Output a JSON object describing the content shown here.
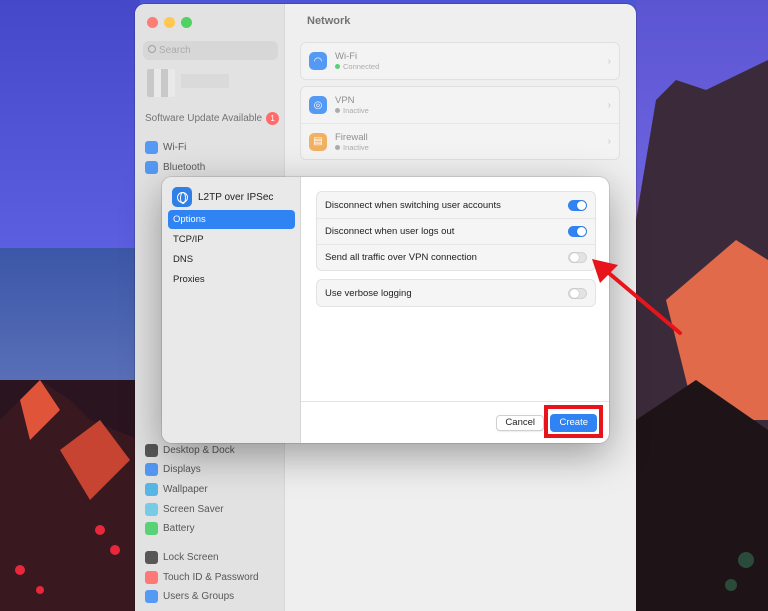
{
  "sidebar": {
    "search_placeholder": "Search",
    "update_text": "Software Update Available",
    "update_badge": "1",
    "items_top": [
      {
        "label": "Wi-Fi",
        "icon": "wifi-icon",
        "color": "#2f83f2"
      },
      {
        "label": "Bluetooth",
        "icon": "bluetooth-icon",
        "color": "#2f83f2"
      }
    ],
    "items_bottom": [
      {
        "label": "Desktop & Dock",
        "icon": "dock-icon",
        "color": "#333333"
      },
      {
        "label": "Displays",
        "icon": "display-icon",
        "color": "#2f83f2"
      },
      {
        "label": "Wallpaper",
        "icon": "wallpaper-icon",
        "color": "#34a7e0"
      },
      {
        "label": "Screen Saver",
        "icon": "screensaver-icon",
        "color": "#5ac0e0"
      },
      {
        "label": "Battery",
        "icon": "battery-icon",
        "color": "#34c759"
      },
      {
        "label": "Lock Screen",
        "icon": "lock-icon",
        "color": "#333333"
      },
      {
        "label": "Touch ID & Password",
        "icon": "fingerprint-icon",
        "color": "#ff5b5b"
      },
      {
        "label": "Users & Groups",
        "icon": "users-icon",
        "color": "#2f83f2"
      }
    ]
  },
  "main": {
    "title": "Network",
    "wifi": {
      "title": "Wi-Fi",
      "status": "Connected",
      "status_color": "#34c759"
    },
    "vpn": {
      "title": "VPN",
      "status": "Inactive",
      "status_color": "#9a9a9a"
    },
    "firewall": {
      "title": "Firewall",
      "status": "Inactive",
      "status_color": "#9a9a9a"
    }
  },
  "dialog": {
    "title": "L2TP over IPSec",
    "nav": [
      "Options",
      "TCP/IP",
      "DNS",
      "Proxies"
    ],
    "options_group1": [
      {
        "label": "Disconnect when switching user accounts",
        "on": true
      },
      {
        "label": "Disconnect when user logs out",
        "on": true
      },
      {
        "label": "Send all traffic over VPN connection",
        "on": false
      }
    ],
    "options_group2": [
      {
        "label": "Use verbose logging",
        "on": false
      }
    ],
    "cancel_label": "Cancel",
    "create_label": "Create"
  },
  "colors": {
    "accent": "#2f83f2",
    "highlight": "#e8141b"
  }
}
